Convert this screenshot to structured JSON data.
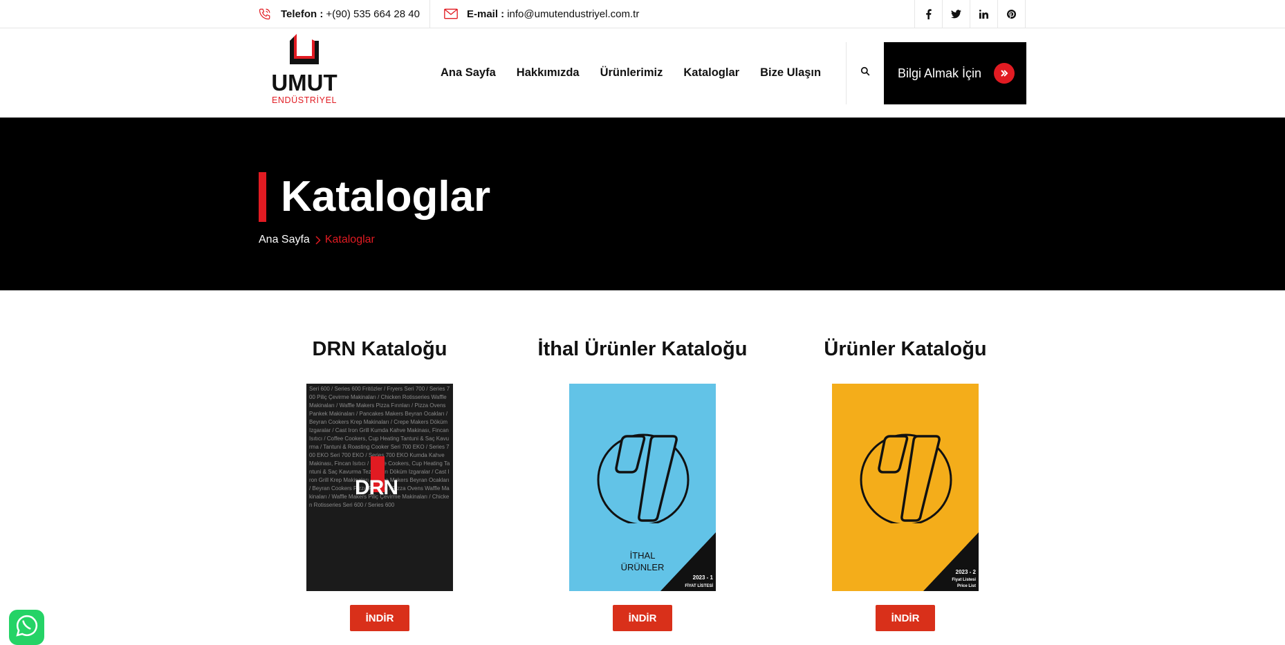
{
  "topbar": {
    "phone_label": "Telefon :",
    "phone_value": "+(90) 535 664 28 40",
    "email_label": "E-mail :",
    "email_value": "info@umutendustriyel.com.tr",
    "socials": [
      "f",
      "t",
      "in",
      "p"
    ]
  },
  "header": {
    "logo_word": "UMUT",
    "logo_sub": "ENDÜSTRİYEL",
    "nav": [
      "Ana Sayfa",
      "Hakkımızda",
      "Ürünlerimiz",
      "Kataloglar",
      "Bize Ulaşın"
    ],
    "cta_label": "Bilgi Almak İçin"
  },
  "hero": {
    "title": "Kataloglar",
    "breadcrumb_home": "Ana Sayfa",
    "breadcrumb_current": "Kataloglar"
  },
  "catalogs": [
    {
      "title": "DRN Kataloğu",
      "button": "İNDİR",
      "cover_brand": "DRN"
    },
    {
      "title": "İthal Ürünler Kataloğu",
      "button": "İNDİR",
      "cover_line1": "İTHAL",
      "cover_line2": "ÜRÜNLER",
      "corner_line1": "2023 - 1",
      "corner_line2": "FİYAT LİSTESİ"
    },
    {
      "title": "Ürünler Kataloğu",
      "button": "İNDİR",
      "corner_line1": "2023 - 2",
      "corner_line2": "Fiyat Listesi",
      "corner_line3": "Price List"
    }
  ],
  "drn_cover_text": "Seri 600 / Series 600 Fritözler / Fryers Seri 700 / Series 700 Piliç Çevirme Makinaları / Chicken Rotisseries Waffle Makinaları / Waffle Makers Pizza Fırınları / Pizza Ovens Pankek Makinaları / Pancakes Makers Beyran Ocakları / Beyran Cookers Krep Makinaları / Crepe Makers Döküm Izgaralar / Cast Iron Grill Kumda Kahve Makinası, Fincan Isıtıcı / Coffee Cookers, Cup Heating Tantuni & Saç Kavurma / Tantuni & Roasting Cooker Seri 700 EKO / Series 700 EKO Seri 700 EKO / Series 700 EKO Kumda Kahve Makinası, Fincan Isıtıcı / Coffee Cookers, Cup Heating Tantuni & Saç Kavurma Tezgahları Döküm Izgaralar / Cast Iron Grill Krep Makinaları / Crepe Makers Beyran Ocakları / Beyran Cookers Pizza Fırınları / Pizza Ovens Waffle Makinaları / Waffle Makers Piliç Çevirme Makinaları / Chicken Rotisseries Seri 600 / Series 600",
  "colors": {
    "accent": "#e11b22",
    "button": "#d9301a",
    "hero_bg": "#000000"
  }
}
